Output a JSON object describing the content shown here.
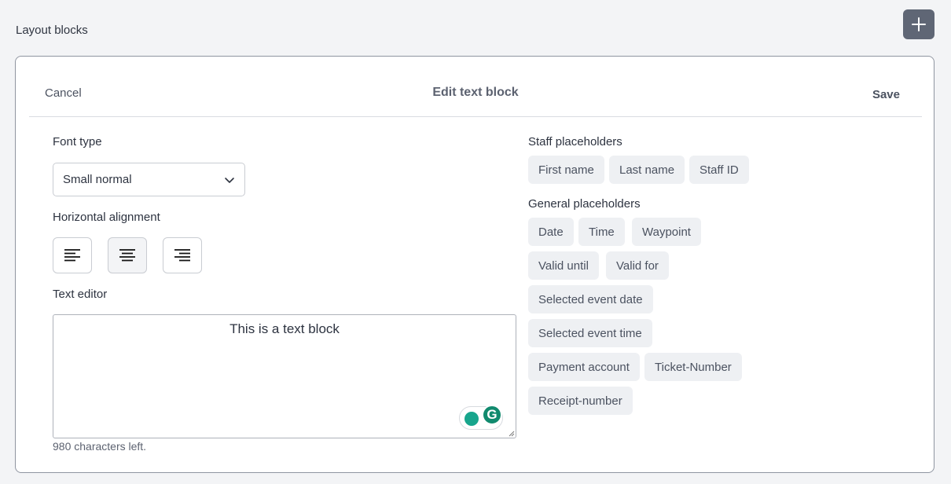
{
  "page": {
    "section_title": "Layout blocks"
  },
  "toolbar": {
    "add_icon": "plus-icon"
  },
  "editor_dialog": {
    "cancel_label": "Cancel",
    "title": "Edit text block",
    "save_label": "Save"
  },
  "font_type": {
    "label": "Font type",
    "selected": "Small normal"
  },
  "alignment": {
    "label": "Horizontal alignment",
    "options": [
      "align-left-icon",
      "align-center-icon",
      "align-right-icon"
    ],
    "selected": "center"
  },
  "text_editor": {
    "label": "Text editor",
    "value": "This is a text block",
    "chars_left": "980 characters left."
  },
  "staff_placeholders": {
    "label": "Staff placeholders",
    "items": [
      "First name",
      "Last name",
      "Staff ID"
    ]
  },
  "general_placeholders": {
    "label": "General placeholders",
    "items": [
      "Date",
      "Time",
      "Waypoint",
      "Valid until",
      "Valid for",
      "Selected event date",
      "Selected event time",
      "Payment account",
      "Ticket-Number",
      "Receipt-number"
    ]
  },
  "colors": {
    "accent_button": "#5f6675",
    "chip_bg": "#eef0f3",
    "grammarly": "#118a6e"
  }
}
